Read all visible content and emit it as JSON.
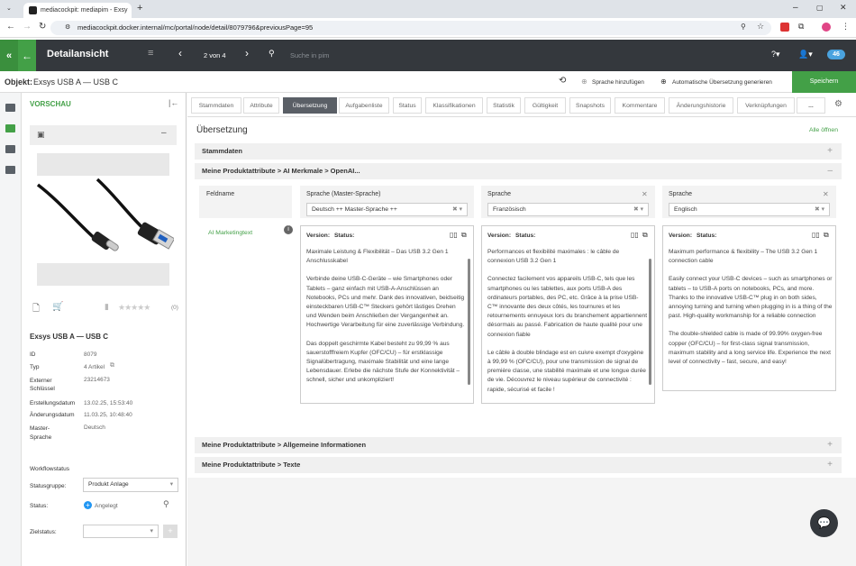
{
  "browser": {
    "tab_title": "mediacockpit: mediapim - Exsy",
    "url": "mediacockpit.docker.internal/mc/portal/node/detail/8079796&previousPage=95"
  },
  "header": {
    "title": "Detailansicht",
    "pager": "2 von 4",
    "search_placeholder": "Suche in pim",
    "badge": "46"
  },
  "object": {
    "label": "Objekt:",
    "name": "Exsys USB A — USB C",
    "add_language": "Sprache hinzufügen",
    "auto_translate": "Automatische Übersetzung generieren",
    "save": "Speichern"
  },
  "preview": {
    "title": "VORSCHAU",
    "rating_count": "(0)",
    "product_name": "Exsys USB A — USB C",
    "props": [
      {
        "label": "ID",
        "value": "8079"
      },
      {
        "label": "Typ",
        "value": "4 Artikel"
      },
      {
        "label": "Externer Schlüssel",
        "value": "23214673"
      },
      {
        "label": "Erstellungsdatum",
        "value": "13.02.25, 15:53:40"
      },
      {
        "label": "Änderungsdatum",
        "value": "11.03.25, 10:48:40"
      },
      {
        "label": "Master-Sprache",
        "value": "Deutsch"
      }
    ],
    "workflow_title": "Workflowstatus",
    "statusgruppe_label": "Statusgruppe:",
    "statusgruppe_value": "Produkt Anlage",
    "status_label": "Status:",
    "status_value": "Angelegt",
    "zielstatus_label": "Zielstatus:"
  },
  "tabs": [
    "Stammdaten",
    "Attribute",
    "Übersetzung",
    "Aufgabenliste",
    "Status",
    "Klassifikationen",
    "Statistik",
    "Gültigkeit",
    "Snapshots",
    "Kommentare",
    "Änderungshistorie",
    "Verknüpfungen",
    "..."
  ],
  "main": {
    "title": "Übersetzung",
    "open_all": "Alle öffnen",
    "sections": {
      "stammdaten": "Stammdaten",
      "ai": "Meine Produktattribute > AI Merkmale > OpenAI...",
      "allg": "Meine Produktattribute > Allgemeine Informationen",
      "texte": "Meine Produktattribute > Texte"
    },
    "feldname": "Feldname",
    "field_name": "AI Marketingtext",
    "version_label": "Version:",
    "status_label": "Status:",
    "columns": [
      {
        "header": "Sprache (Master-Sprache)",
        "select": "Deutsch ++ Master-Sprache ++",
        "paragraphs": [
          "Maximale Leistung & Flexibilität – Das USB 3.2 Gen 1 Anschlusskabel",
          "Verbinde deine USB-C-Geräte – wie Smartphones oder Tablets – ganz einfach mit USB-A-Anschlüssen an Notebooks, PCs und mehr. Dank des innovativen, beidseitig einsteckbaren USB-C™ Steckers gehört lästiges Drehen und Wenden beim Anschließen der Vergangenheit an. Hochwertige Verarbeitung für eine zuverlässige Verbindung.",
          "Das doppelt geschirmte Kabel besteht zu 99,99 % aus sauerstofffreiem Kupfer (OFC/CU) – für erstklassige Signalübertragung, maximale Stabilität und eine lange Lebensdauer. Erlebe die nächste Stufe der Konnektivität – schnell, sicher und unkompliziert!"
        ]
      },
      {
        "header": "Sprache",
        "select": "Französisch",
        "paragraphs": [
          "Performances et flexibilité maximales : le câble de connexion USB 3.2 Gen 1",
          "Connectez facilement vos appareils USB-C, tels que les smartphones ou les tablettes, aux ports USB-A des ordinateurs portables, des PC, etc. Grâce à la prise USB-C™ innovante des deux côtés, les tournures et les retournements ennuyeux lors du branchement appartiennent désormais au passé. Fabrication de haute qualité pour une connexion fiable",
          "Le câble à double blindage est en cuivre exempt d'oxygène à 99,99 % (OFC/CU), pour une transmission de signal de première classe, une stabilité maximale et une longue durée de vie. Découvrez le niveau supérieur de connectivité : rapide, sécurisé et facile !"
        ]
      },
      {
        "header": "Sprache",
        "select": "Englisch",
        "paragraphs": [
          "Maximum performance & flexibility – The USB 3.2 Gen 1 connection cable",
          "Easily connect your USB-C devices – such as smartphones or tablets – to USB-A ports on notebooks, PCs, and more. Thanks to the innovative USB-C™ plug in on both sides, annoying turning and turning when plugging in is a thing of the past. High-quality workmanship for a reliable connection",
          "The double-shielded cable is made of 99.99% oxygen-free copper (OFC/CU) – for first-class signal transmission, maximum stability and a long service life. Experience the next level of connectivity – fast, secure, and easy!"
        ]
      }
    ]
  },
  "colors": {
    "accent_green": "#43a047",
    "header_dark": "#34383d",
    "active_tab": "#5a5f66"
  }
}
